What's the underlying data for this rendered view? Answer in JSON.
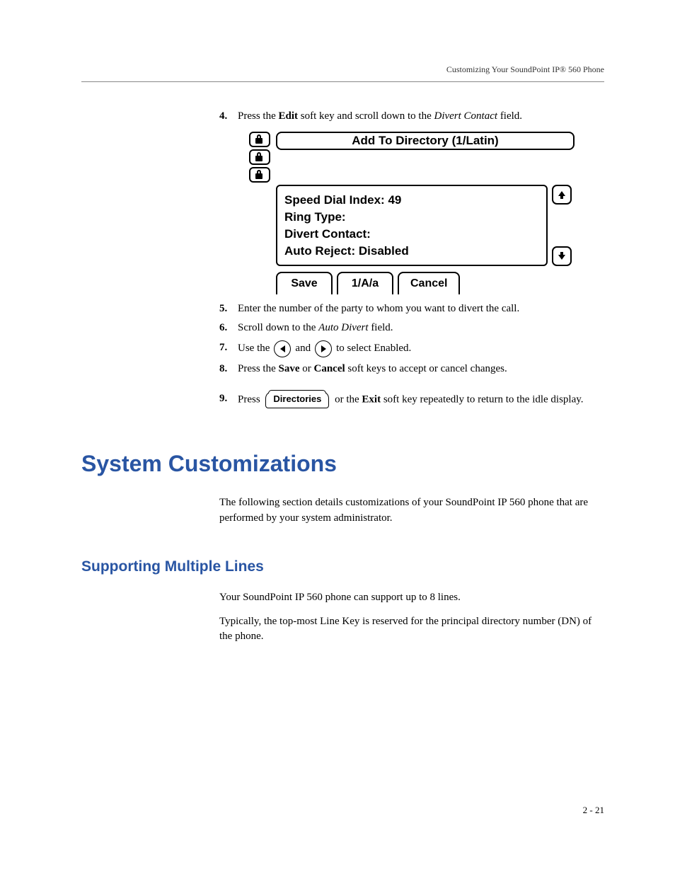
{
  "header": {
    "running_head": "Customizing Your SoundPoint IP® 560 Phone"
  },
  "steps": {
    "s4": {
      "num": "4.",
      "pre": "Press the ",
      "bold": "Edit",
      "mid": " soft key and scroll down to the ",
      "ital": "Divert Contact",
      "post": " field."
    },
    "s5": {
      "num": "5.",
      "text": "Enter the number of the party to whom you want to divert the call."
    },
    "s6": {
      "num": "6.",
      "pre": "Scroll down to the ",
      "ital": "Auto Divert",
      "post": " field."
    },
    "s7": {
      "num": "7.",
      "pre": "Use the ",
      "mid": " and ",
      "post": " to select Enabled."
    },
    "s8": {
      "num": "8.",
      "pre": "Press the ",
      "b1": "Save",
      "mid": " or ",
      "b2": "Cancel",
      "post": " soft keys to accept or cancel changes."
    },
    "s9": {
      "num": "9.",
      "pre": "Press ",
      "key": "Directories",
      "mid": " or the ",
      "b1": "Exit",
      "post": " soft key repeatedly to return to the idle display."
    }
  },
  "phone": {
    "title": "Add To Directory (1/Latin)",
    "lines": {
      "l1_label": "Speed Dial Index:",
      "l1_val": "49",
      "l2": "Ring Type:",
      "l3": "Divert Contact:",
      "l4_label": "Auto Reject:",
      "l4_val": "Disabled"
    },
    "softkeys": {
      "k1": "Save",
      "k2": "1/A/a",
      "k3": "Cancel"
    }
  },
  "sections": {
    "h1": "System Customizations",
    "p1": "The following section details customizations of your SoundPoint IP 560 phone that are performed by your system administrator.",
    "h2": "Supporting Multiple Lines",
    "p2": "Your SoundPoint IP 560 phone can support up to 8 lines.",
    "p3": "Typically, the top-most Line Key is reserved for the principal directory number (DN) of the phone."
  },
  "footer": {
    "pagenum": "2 - 21"
  }
}
